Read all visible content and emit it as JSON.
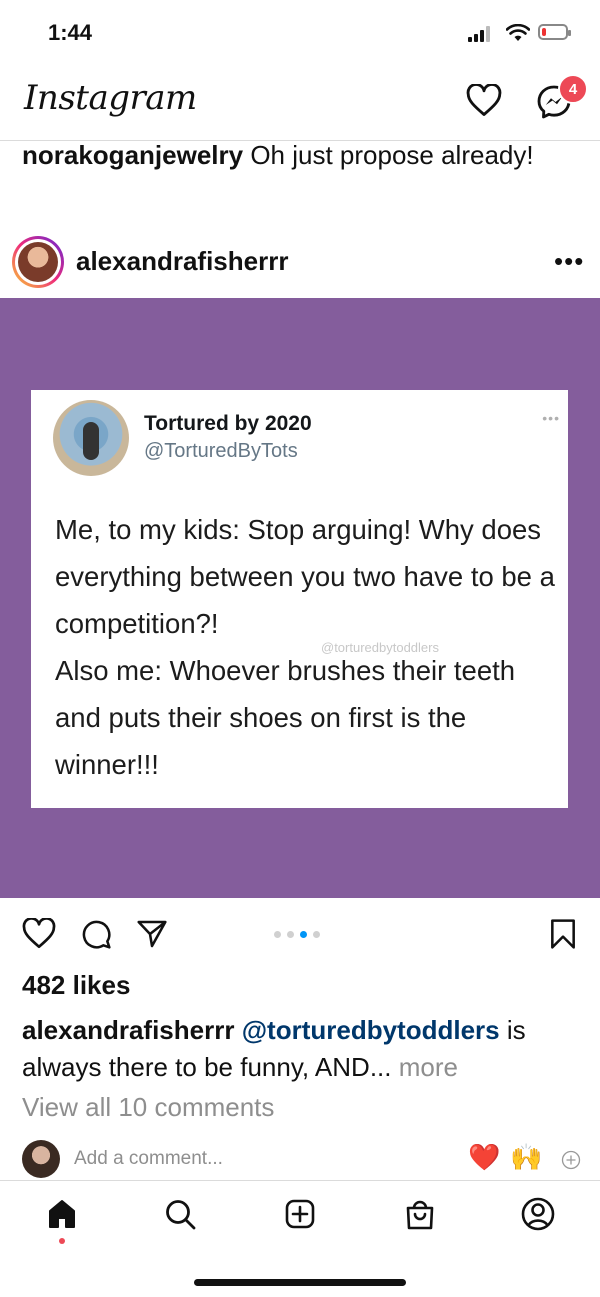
{
  "status_bar": {
    "time": "1:44",
    "battery_level": 0.15
  },
  "header": {
    "logo_text": "Instagram",
    "messenger_badge": "4"
  },
  "prev_comment": {
    "username": "norakoganjewelry",
    "text": "Oh just propose already!"
  },
  "post": {
    "username": "alexandrafisherrr",
    "more_icon": "more-dots-icon",
    "background_color": "#845d9c",
    "tweet": {
      "name": "Tortured by 2020",
      "handle": "@TorturedByTots",
      "text_line1": "Me, to my kids: Stop arguing! Why does everything between you two have to be a competition?!",
      "text_line2": "Also me: Whoever brushes their teeth and puts their shoes on first is the winner!!!",
      "watermark": "@torturedbytoddlers"
    },
    "carousel": {
      "count": 4,
      "active_index": 2
    },
    "likes": "482 likes",
    "caption": {
      "username": "alexandrafisherrr",
      "mention": "@torturedbytoddlers",
      "text": "is always there to be funny, AND...",
      "more": "more"
    },
    "view_all": "View all 10 comments",
    "add_comment_placeholder": "Add a comment...",
    "quick_reactions": [
      "❤️",
      "🙌"
    ]
  },
  "tab_bar": {
    "items": [
      "home",
      "search",
      "create",
      "shop",
      "profile"
    ],
    "active": "home"
  },
  "icons": {
    "heart": "heart-icon",
    "messenger": "messenger-icon",
    "comment": "comment-icon",
    "share": "share-icon",
    "save": "bookmark-icon",
    "add": "plus-circle-icon"
  }
}
